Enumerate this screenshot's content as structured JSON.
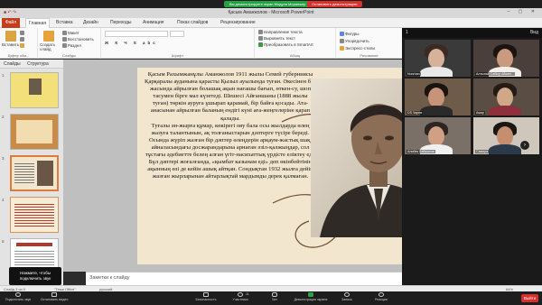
{
  "zoom": {
    "share_banner": "Вы демонстрируете экран Модуля Моранжер",
    "stop_share": "Остановить демонстрацию",
    "gallery": {
      "label": "Вид",
      "count": "1"
    },
    "participants": [
      {
        "name": "Nurzhan"
      },
      {
        "name": "Алтынай Сабыр Айжан..."
      },
      {
        "name": "DS Чирия"
      },
      {
        "name": "Ажар"
      },
      {
        "name": "Алибек Байжанов"
      },
      {
        "name": "Самира"
      }
    ],
    "hover_tip": "Нажмите, чтобы подключить звук",
    "controls": {
      "audio": "Подключить звук",
      "video": "Остановить видео",
      "security": "Безопасность",
      "participants": "Участники",
      "participants_count": "11",
      "chat": "Чат",
      "share": "Демонстрация экрана",
      "record": "Запись",
      "reactions": "Реакции",
      "end": "Выйти"
    }
  },
  "ppt": {
    "title": "Қасым Аманжолов - Microsoft PowerPoint",
    "tabs": {
      "file": "Файл",
      "home": "Главная",
      "insert": "Вставка",
      "design": "Дизайн",
      "transitions": "Переходы",
      "animation": "Анимация",
      "slideshow": "Показ слайдов",
      "review": "Рецензирование"
    },
    "ribbon": {
      "paste": "Вставить",
      "cut": "Вырезать",
      "copy": "Копировать",
      "format": "Формат",
      "clipboard_group": "Буфер обм...",
      "new_slide": "Создать слайд",
      "layout": "Макет",
      "reset": "Восстановить",
      "section": "Раздел",
      "slides_group": "Слайды",
      "font_group": "Шрифт",
      "paragraph_group": "Абзац",
      "text_direction": "Направление текста",
      "align_text": "Выровнять текст",
      "smartart": "Преобразовать в SmartArt",
      "figures": "Фигуры",
      "arrange": "Упорядочить",
      "quick_styles": "Экспресс-стили",
      "drawing_group": "Рисование"
    },
    "pane_tabs": {
      "slides": "Слайды",
      "outline": "Структура"
    },
    "thumb_numbers": [
      "1",
      "2",
      "3",
      "4",
      "5"
    ],
    "slide_text": [
      "Қасым Рахымжанұлы Аманжолов 1911 жылы Семей губерниясы Қарқаралы ауданына қарасты Қызыл ауылында туған. Әкесінен бес жасында айрылған болашақ ақын нағашы бағып, өткен-су, шоп тасумен бірге мал күзетеді. Шешесі Айғаншаны (1888 жылы туған) төркін ауруға ұшырап қарамай, бір байға қосады. Ата-анасынан айрылған баланың ендігі күні аға-жеңгелеріне қарап қалады.",
      "Туғалы ән-жырға құмар, көкірегі ояу бала осы жылдарда өлең жазуға талантынын, ақ толғаныстарын дәптерге түсіре береді. Осында жүріп жазған бір дәптер өлеңдерін арқаум-жастық шақ, айналасындағы досжарандарына арнаған әзіл-қалжыңдар, сол тұстағы әдебиетте белең алған үгіт-насихаттық үрдісте еліктеу еді. Бұл дәптері жоғалғанда, «қымбат казынам еді» деп өкінбейтінін ақынның өзі де кейін ашық айтқан. Сондықтан 1932 жылға дейін жазған жырларынан айтарлықтай мардымды дерек қалмаған."
    ],
    "notes_placeholder": "Заметки к слайду",
    "status": {
      "slide": "Слайд 3 из 9",
      "theme": "\"Тема Office\"",
      "lang": "русский",
      "zoom": "64%"
    }
  }
}
